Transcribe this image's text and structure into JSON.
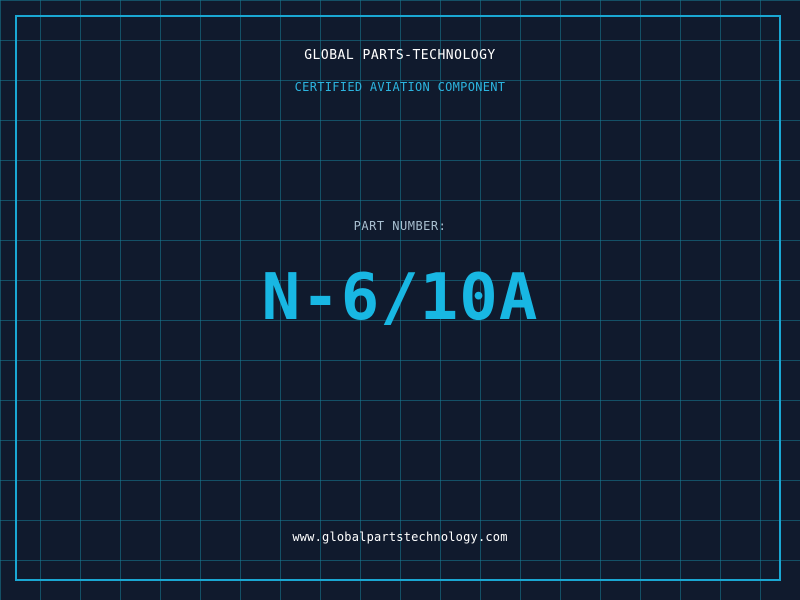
{
  "header": {
    "brand": "GLOBAL PARTS-TECHNOLOGY",
    "subtitle": "CERTIFIED AVIATION COMPONENT"
  },
  "part": {
    "label": "PART NUMBER:",
    "number": "N-6/10A"
  },
  "footer": {
    "website": "www.globalpartstechnology.com"
  },
  "colors": {
    "background": "#101a2d",
    "grid": "#187c96",
    "frame": "#1aa7d3",
    "accent": "#18b7e3",
    "text_primary": "#ffffff",
    "text_secondary": "#a9bfd0"
  }
}
